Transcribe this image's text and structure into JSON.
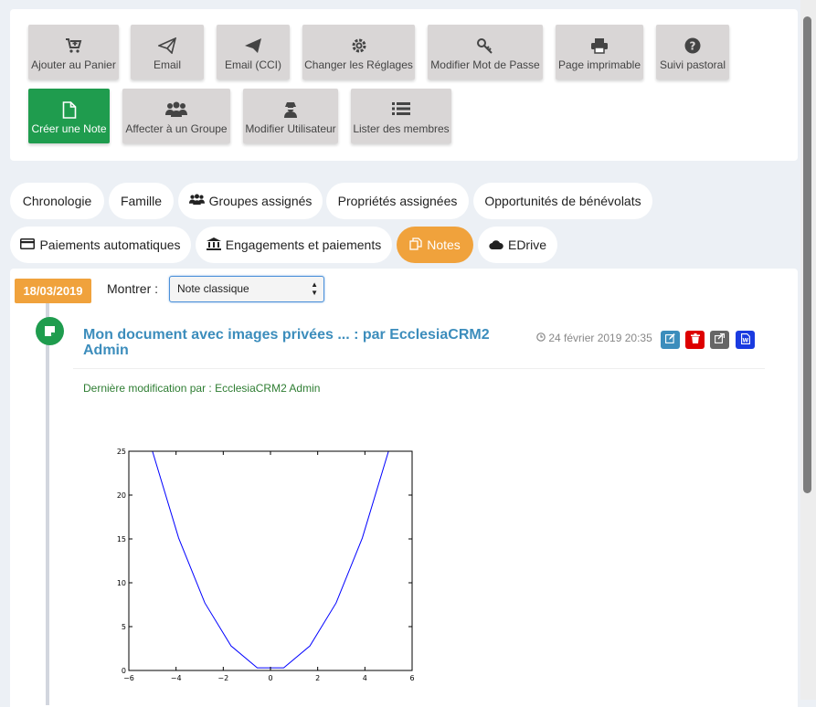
{
  "toolbar": {
    "buttons": [
      {
        "label": "Ajouter au Panier",
        "icon": "cart-plus-icon"
      },
      {
        "label": "Email",
        "icon": "paper-plane-outline-icon"
      },
      {
        "label": "Email (CCI)",
        "icon": "paper-plane-icon"
      },
      {
        "label": "Changer les Réglages",
        "icon": "gear-icon"
      },
      {
        "label": "Modifier Mot de Passe",
        "icon": "key-icon"
      },
      {
        "label": "Page imprimable",
        "icon": "printer-icon"
      },
      {
        "label": "Suivi pastoral",
        "icon": "question-circle-icon"
      },
      {
        "label": "Créer une Note",
        "icon": "file-icon"
      },
      {
        "label": "Affecter à un Groupe",
        "icon": "users-icon"
      },
      {
        "label": "Modifier Utilisateur",
        "icon": "user-secret-icon"
      },
      {
        "label": "Lister des membres",
        "icon": "list-icon"
      }
    ]
  },
  "tabs": {
    "chronologie": "Chronologie",
    "famille": "Famille",
    "groupes": "Groupes assignés",
    "proprietes": "Propriétés assignées",
    "opportunites": "Opportunités de bénévolats",
    "paiements": "Paiements automatiques",
    "engagements": "Engagements et paiements",
    "notes": "Notes",
    "edrive": "EDrive"
  },
  "timeline": {
    "date_badge": "18/03/2019",
    "show_label": "Montrer :",
    "filter_value": "Note classique"
  },
  "note": {
    "title": "Mon document avec images privées ... : par EcclesiaCRM2 Admin",
    "date": "24 février 2019 20:35",
    "modified_by": "Dernière modification par : EcclesiaCRM2 Admin"
  },
  "colors": {
    "accent_orange": "#f0a23c",
    "green": "#1f9c4e",
    "title_blue": "#3c8dbc",
    "edit_blue": "#3c8dbc",
    "delete_red": "#dd0000",
    "share_grey": "#666666",
    "word_blue": "#1a3be0"
  },
  "chart_data": {
    "type": "line",
    "x": [
      -5,
      -3.89,
      -2.78,
      -1.67,
      -0.56,
      0.56,
      1.67,
      2.78,
      3.89,
      5
    ],
    "y": [
      25,
      15.1,
      7.7,
      2.8,
      0.3,
      0.3,
      2.8,
      7.7,
      15.1,
      25
    ],
    "xlim": [
      -6,
      6
    ],
    "ylim": [
      0,
      25
    ],
    "xticks": [
      "−6",
      "−4",
      "−2",
      "0",
      "2",
      "4",
      "6"
    ],
    "yticks": [
      "0",
      "5",
      "10",
      "15",
      "20",
      "25"
    ],
    "xtick_values": [
      -6,
      -4,
      -2,
      0,
      2,
      4,
      6
    ],
    "ytick_values": [
      0,
      5,
      10,
      15,
      20,
      25
    ],
    "line_color": "#0000ff",
    "grid": false
  }
}
